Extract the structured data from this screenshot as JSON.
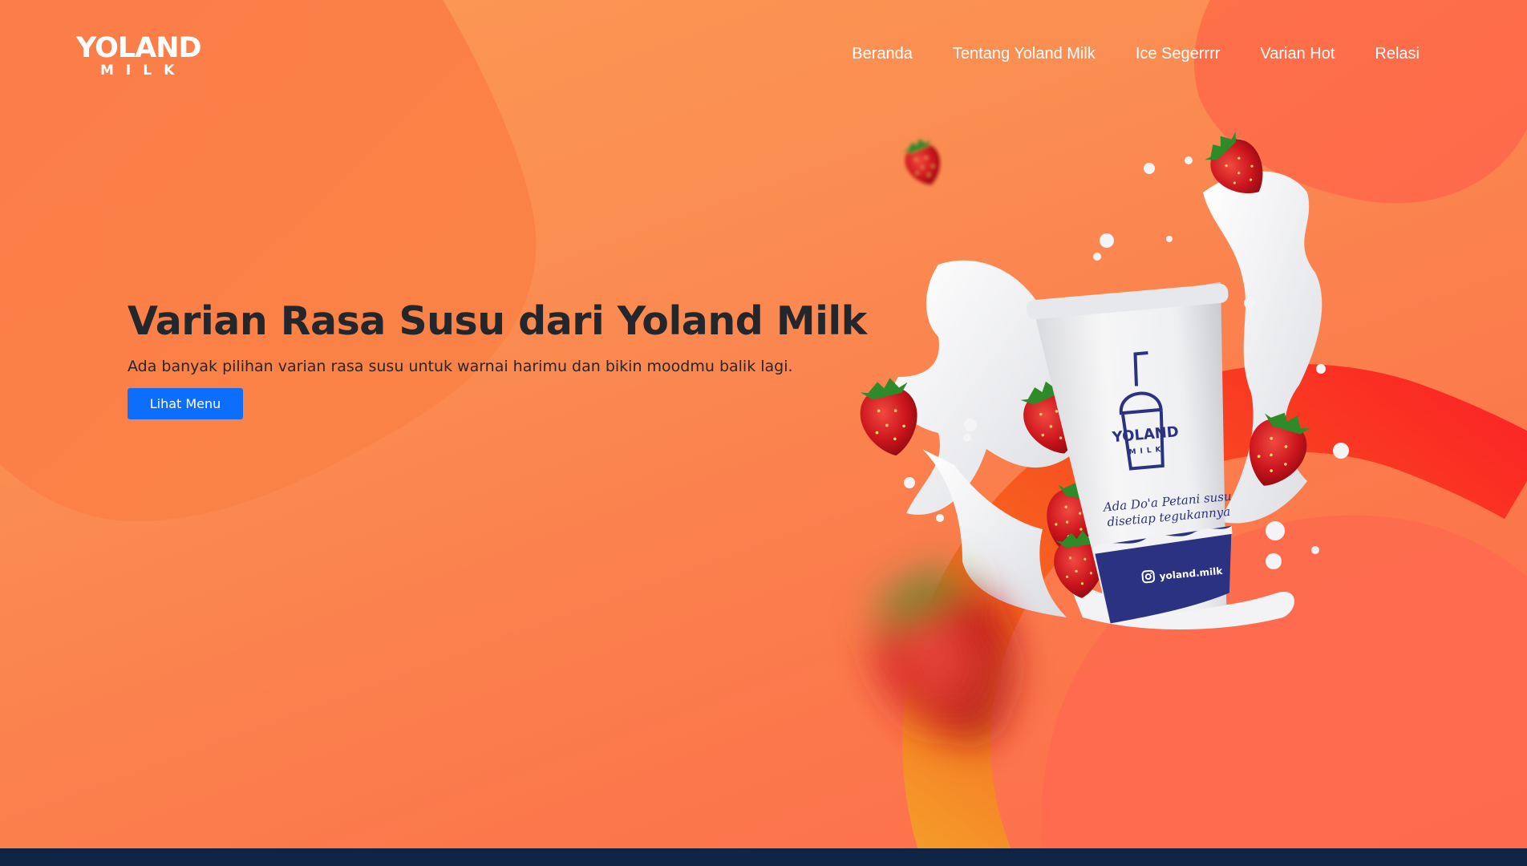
{
  "brand": {
    "logo_top": "YOLAND",
    "logo_bottom": "MILK"
  },
  "nav": {
    "items": [
      "Beranda",
      "Tentang Yoland Milk",
      "Ice Segerrrr",
      "Varian Hot",
      "Relasi"
    ]
  },
  "hero": {
    "title": "Varian Rasa Susu dari Yoland Milk",
    "subtitle": "Ada banyak pilihan varian rasa susu untuk warnai harimu dan bikin moodmu balik lagi.",
    "button_label": "Lihat Menu"
  },
  "cup": {
    "logo_top": "YOLAND",
    "logo_bottom": "MILK",
    "tagline_line1": "Ada Do'a Petani susu",
    "tagline_line2": "disetiap tegukannya",
    "handle": "yoland.milk"
  },
  "colors": {
    "background": "#fb8f52",
    "button": "#0d6efd",
    "cup_band": "#2b3282",
    "footer_strip": "#0f2444"
  },
  "icons": [
    "strawberry-icon",
    "instagram-icon",
    "cup-logo-icon"
  ]
}
